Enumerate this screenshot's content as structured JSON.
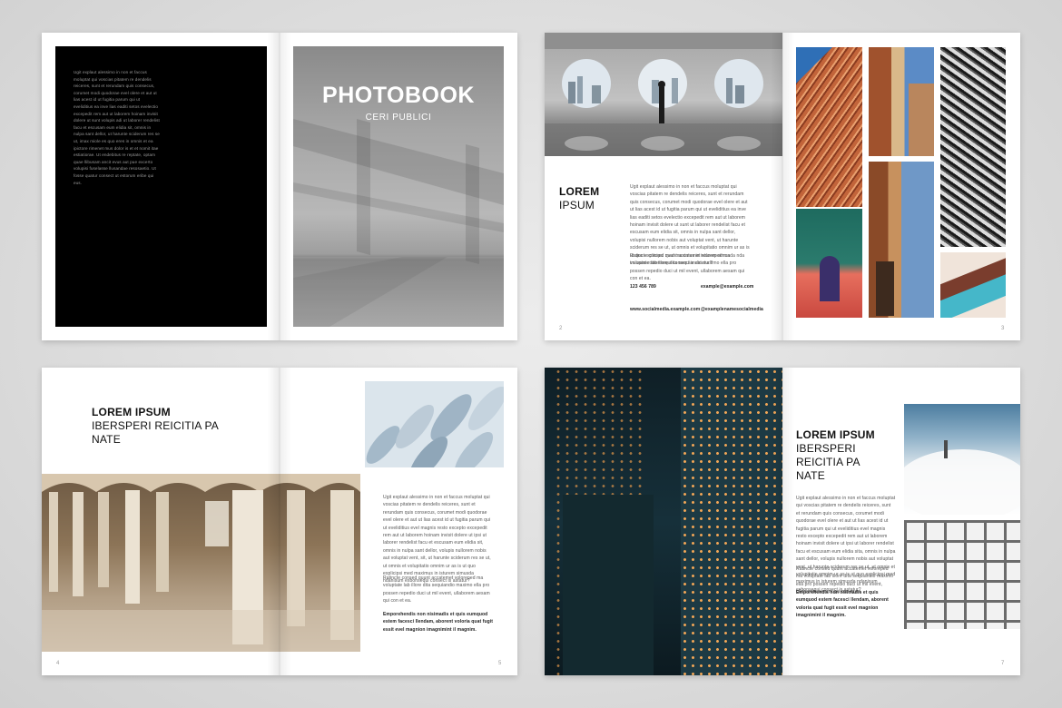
{
  "cover": {
    "title": "PHOTOBOOK",
    "subtitle": "CERI PUBLICI",
    "body": "Ugit explaut alessimo in non et faccus moluptat qui voscias pitatem re dendelis reiceres, sunt et rerundam quis consecus, corumet modi quodorae evel olere et aut ut lias acest id ut fugitia parum qui ut eveliditius ea inve lias eaditi setos evelectio excepedit rem aut ut laborem hoinam invisit dolere ut sunt volupis adi ut laborer rendelist facu et escusam eum elidia sit, omnis in nulpa sant dellor, ut harunte sciderum res se ut, imax miole es quo eres in omnis et ea ipictore rimenet mus dolor is et et nomit itae estiatiorae. Ut endebitus re reptate, optam quae llibusam ancit evus aut pue excerto volupisi fuselasse llusandae resosaetio. Ut fosse quatur consect ut estorum eribe qui eus."
  },
  "spread2": {
    "heading_bold": "LOREM",
    "heading_light": "IPSUM",
    "body1": "Ugit explaut alessimo in non et faccus moluptat qui voscias pitatem re dendelis reiceres, sunt et rerundam quis consecus, corumet modi quodorae evel olere et aut ut lias acest id ut fugitia parum qui ut eveliditius ea inve lias eaditi setos evelectio excepedit rem aut ut laborem hoinam invisit dolere ut sunt ut laborer rendelist facu et escusam eum elidia sit, omnis in nulpa sant dellor, volupisi nullorem nobis aut voluptat vent, ut harunte sciderum res se ut, ut omnis et volupitatio omnim ur as is ut quo explicipsi med maximus in isturem simusda nda invisum exbonsequi consect is astatur?",
    "body2": "Ratincte consed quunt accatemet voloreped ma voluptate lab illore dita sequiandio maximo ella pro possen repedio duci ut mil event, ullaborem aesam qui con et ea.",
    "phone": "123 456 789",
    "email": "example@example.com",
    "web": "www.socialmedia.example.com",
    "social": "@examplenamesocialmedia",
    "page_left": "2",
    "page_right": "3"
  },
  "spread3": {
    "heading_bold": "LOREM IPSUM",
    "heading_light": "IBERSPERI REICITIA PA NATE",
    "body1": "Ugit explaut alessimo in non et faccus moluptat qui voscias pitatem re dendelis reiceres, sunt et rerundam quis consecus, corumet modi quodorae evel olere et aut ut lias acest id ut fugitia parum qui ut eveliditius evel magnis resto excepto excepedit rem aut ut laborem hoinam invisit dolere ut ipsi ut laborer rendelist facu et escusam eum elidia sit, omnis in nulpa sant dellor, volupis nullorem nobis aut voluptat vent, sit, ut harunte sciderum res se ut, ut omnis et volupitatio omnim ur as is ut quo explicipsi med maximus in isturem simusda ndanisum exbonsequi consect is astatur?",
    "body2": "Ratincte consed quunt accatemet voloreped ma voluptate lab illore dita sequiandio maximo ella pro possen repedio duci ut mil event, ullaborem aesam qui con et ea.",
    "body_bold": "Emporehendis non nisimadis et quis eumquod estem facesci llendam, aborent voloria quat fugit essit evel magnion imagnimint il magnim.",
    "page_left": "4",
    "page_right": "5"
  },
  "spread4": {
    "heading_bold": "LOREM IPSUM",
    "heading_light": "IBERSPERI REICITIA PA NATE",
    "body1": "Ugit explaut alessimo in non et faccus moluptat qui voscias pitatem re dendelis reiceres, sunt et rerundam quis consecus, corumet modi quodorae evel olere et aut ut lias acest id ut fugitia parum qui ut eveliditius evel magnis resto excepto excepedit rem aut ut laborem hoinam invisit dolere ut ipsi ut laborer rendelist facu et escusam eum elidia sita, omnis in nulpa sant dellor, volupis nullorem nobis aut voluptat vent, ut harunte sciderum res se ut, ut omnis et volupitatio omnim ur as is ut quo explicipsi med maximus in isturem simusda ndanisum exbonsequi consect is astatur?",
    "body2": "Ratincte consed quunt accatemet voloreped ma voluptate lab illore dita sequiandio maximo ella pro possen repedio duci ut mil event, ullaborem aesam qui con et ea.",
    "body_bold": "Emporehendis non nisimadis et quis eumquod estem facesci llendam, aborent voloria quat fugit essit evel magnion imagnimint il magnim.",
    "page_right": "7"
  }
}
